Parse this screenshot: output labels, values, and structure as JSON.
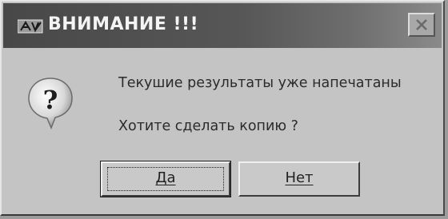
{
  "dialog": {
    "title": "ВНИМАНИЕ !!!",
    "message_line1": "Текушие результаты уже напечатаны",
    "message_line2": "Хотите сделать копию ?",
    "buttons": {
      "yes_label": "Да",
      "no_label": "Нет"
    },
    "icons": {
      "title": "app-icon",
      "body": "question-icon",
      "close": "close-icon"
    }
  }
}
